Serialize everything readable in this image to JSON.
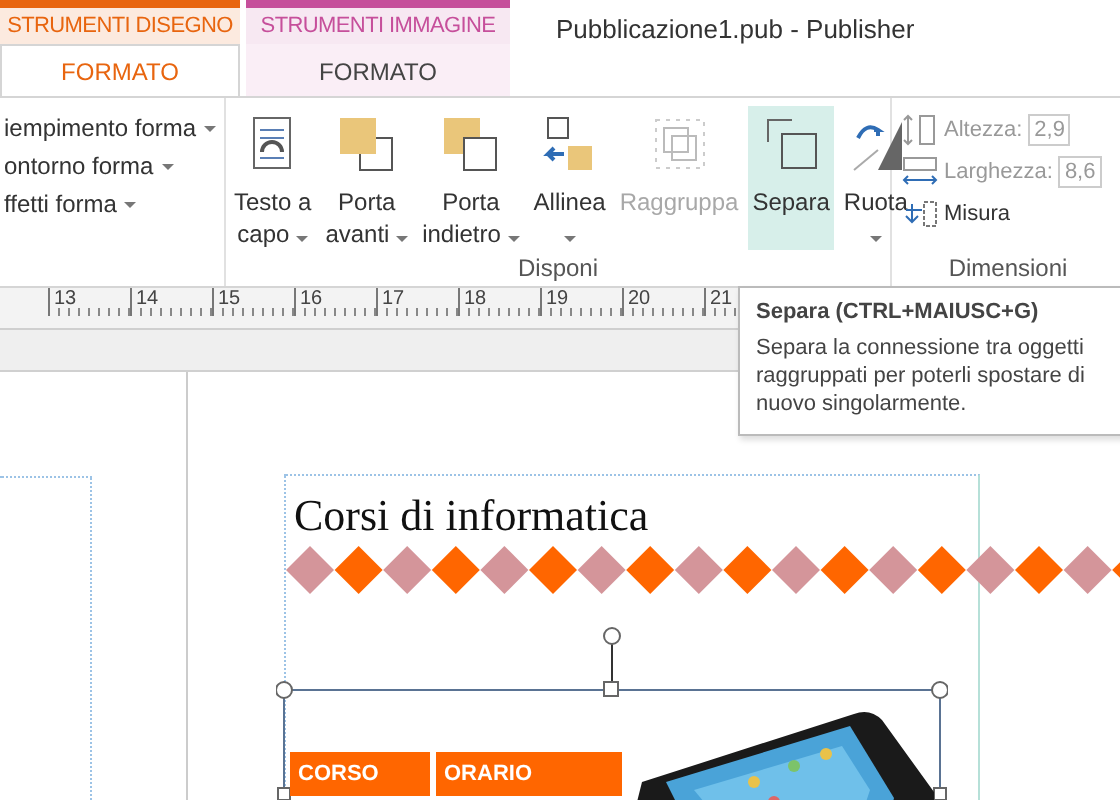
{
  "context_tabs": [
    {
      "group": "STRUMENTI DISEGNO",
      "tab": "FORMATO",
      "color": "#e8650f",
      "selected": true
    },
    {
      "group": "STRUMENTI IMMAGINE",
      "tab": "FORMATO",
      "color": "#c64f9b",
      "selected": false
    }
  ],
  "window": {
    "title": "Pubblicazione1.pub - Publisher"
  },
  "shape_menu": [
    {
      "label": "iempimento forma"
    },
    {
      "label": "ontorno forma"
    },
    {
      "label": "ffetti forma"
    }
  ],
  "arrange_group": {
    "label": "Disponi",
    "buttons": [
      {
        "line1": "Testo a",
        "line2": "capo",
        "has_menu": true,
        "disabled": false,
        "selected": false
      },
      {
        "line1": "Porta",
        "line2": "avanti",
        "has_menu": true,
        "disabled": false,
        "selected": false
      },
      {
        "line1": "Porta",
        "line2": "indietro",
        "has_menu": true,
        "disabled": false,
        "selected": false
      },
      {
        "line1": "Allinea",
        "has_menu": true,
        "disabled": false,
        "selected": false
      },
      {
        "line1": "Raggruppa",
        "has_menu": false,
        "disabled": true,
        "selected": false
      },
      {
        "line1": "Separa",
        "has_menu": false,
        "disabled": false,
        "selected": true
      },
      {
        "line1": "Ruota",
        "has_menu": true,
        "disabled": false,
        "selected": false
      }
    ]
  },
  "size_group": {
    "label": "Dimensioni",
    "height_label": "Altezza:",
    "height_value": "2,9",
    "width_label": "Larghezza:",
    "width_value": "8,6",
    "measure": "Misura"
  },
  "ruler": [
    "13",
    "14",
    "15",
    "16",
    "17",
    "18",
    "19",
    "20",
    "21"
  ],
  "tooltip": {
    "title": "Separa (CTRL+MAIUSC+G)",
    "text": "Separa la connessione tra oggetti raggruppati per poterli spostare di nuovo singolarmente."
  },
  "document": {
    "heading": "Corsi di informatica",
    "table_columns": [
      "CORSO",
      "ORARIO"
    ]
  }
}
